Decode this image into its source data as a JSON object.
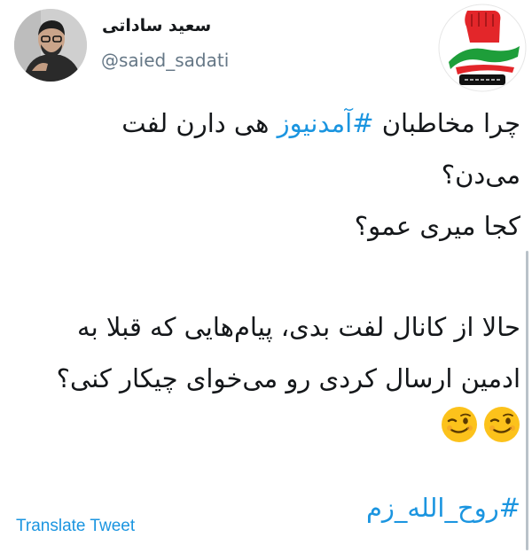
{
  "tweet": {
    "author_name": "سعید ساداتی",
    "author_handle": "@saied_sadati",
    "line1_prefix": "چرا مخاطبان ",
    "line1_hashtag": "#آمدنیوز",
    "line1_suffix": " هی دارن لفت",
    "line2": "می‌دن؟",
    "line3": "کجا میری عمو؟",
    "line4": "حالا از کانال لفت بدی، پیام‌هایی که قبلا به",
    "line5": "ادمین ارسال کردی رو می‌خوای چیکار کنی؟",
    "emojis": [
      "winking-face-icon",
      "winking-face-icon"
    ],
    "hashtag": "#روح_الله_زم",
    "translate_label": "Translate Tweet"
  },
  "watermark": {
    "logo_text_main": "عدالت",
    "logo_text_sub": "خواهان",
    "colors": {
      "red": "#e3262a",
      "green": "#1e9e3a",
      "black": "#111111"
    }
  },
  "colors": {
    "link": "#1b95e0",
    "text": "#14171a",
    "muted": "#657786"
  }
}
